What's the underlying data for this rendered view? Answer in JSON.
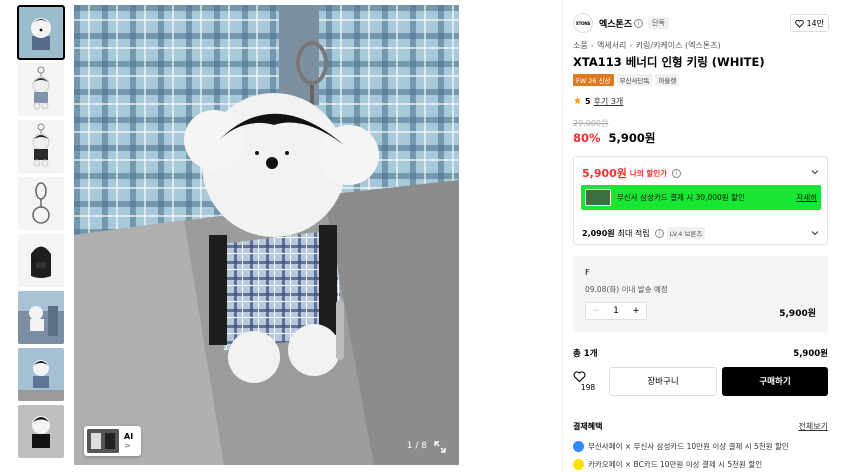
{
  "thumbnails": [
    {
      "name": "thumb-1",
      "selected": true
    },
    {
      "name": "thumb-2",
      "selected": false
    },
    {
      "name": "thumb-3",
      "selected": false
    },
    {
      "name": "thumb-4",
      "selected": false
    },
    {
      "name": "thumb-5",
      "selected": false
    },
    {
      "name": "thumb-6",
      "selected": false
    },
    {
      "name": "thumb-7",
      "selected": false
    },
    {
      "name": "thumb-8",
      "selected": false
    }
  ],
  "gallery": {
    "counter": "1 / 8",
    "ai_label": "AI",
    "ai_arrow": ">",
    "expand_icon": "expand-icon"
  },
  "brand": {
    "logo_text": "XTONS",
    "name": "엑스톤즈",
    "info": "i",
    "badge": "단독",
    "like_icon": "heart-outline-icon",
    "like_count": "14만"
  },
  "breadcrumb": {
    "items": [
      "소품",
      "액세서리",
      "키링/키케이스 (엑스톤즈)"
    ],
    "separator": "›"
  },
  "product": {
    "title": "XTA113 베너디 인형 키링 (WHITE)",
    "tags": [
      "FW 26 신상",
      "무신사단독",
      "아울렛"
    ],
    "rating_score": "5",
    "review_text": "후기 3개",
    "original_price": "29,000원",
    "discount_rate": "80%",
    "sale_price": "5,900원"
  },
  "discount_box": {
    "my_price": "5,900원",
    "my_price_label": "나의 할인가",
    "info": "i",
    "card_text": "무신사 삼성카드 결제 시 30,000원 할인",
    "card_link": "자세히",
    "points_amount": "2,090원",
    "points_label": "최대 적립",
    "points_level": "LV.4 브론즈"
  },
  "option": {
    "name": "F",
    "shipping": "09.08(화) 이내 발송 예정",
    "minus": "−",
    "quantity": "1",
    "plus": "+",
    "price": "5,900원"
  },
  "total": {
    "label": "총 1개",
    "price": "5,900원"
  },
  "actions": {
    "wish_count": "198",
    "cart_label": "장바구니",
    "buy_label": "구매하기"
  },
  "benefits": {
    "heading": "결제혜택",
    "more": "전체보기",
    "items": [
      {
        "text": "무신사페이 × 무신사 삼성카드 10만원 이상 결제 시 5천원 할인",
        "color": "#2f8cff"
      },
      {
        "text": "카카오페이 × BC카드 10만원 이상 결제 시 5천원 할인",
        "color": "#ffe100"
      }
    ]
  },
  "colors": {
    "accent_red": "#ff2b2b",
    "card_banner": "#19e632",
    "star": "#ff9a00",
    "buy_button": "#000000"
  }
}
